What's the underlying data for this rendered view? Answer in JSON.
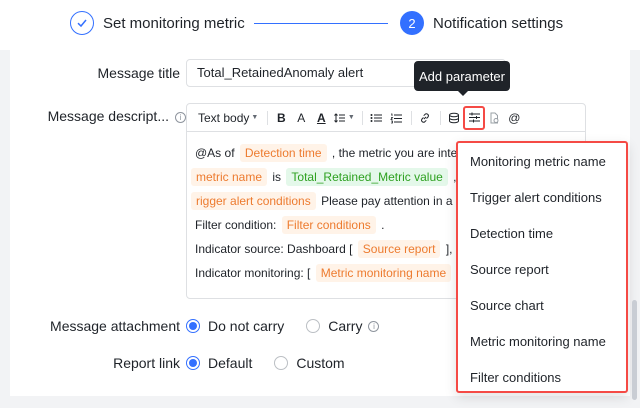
{
  "steps": [
    {
      "number": "",
      "label": "Set monitoring metric",
      "status": "done"
    },
    {
      "number": "2",
      "label": "Notification settings",
      "status": "active"
    }
  ],
  "form": {
    "message_title_label": "Message title",
    "message_title_value": "Total_RetainedAnomaly alert",
    "message_desc_label": "Message descript...",
    "attachment_label": "Message attachment",
    "attachment_options": [
      "Do not carry",
      "Carry"
    ],
    "attachment_selected": "Do not carry",
    "report_link_label": "Report link",
    "report_link_options": [
      "Default",
      "Custom"
    ],
    "report_link_selected": "Default"
  },
  "toolbar": {
    "text_style": "Text body",
    "icons": [
      "caret-down-icon",
      "bold-icon",
      "font-color-icon",
      "text-color-icon",
      "line-height-icon",
      "bullet-list-icon",
      "numbered-list-icon",
      "link-icon",
      "database-icon",
      "add-parameter-icon",
      "attachment-icon",
      "mention-icon"
    ]
  },
  "editor_content": {
    "line1": {
      "t1": "@As of",
      "tag1": "Detection time",
      "t2": ", the metric you are inte"
    },
    "line2": {
      "tag1": "metric name",
      "t1": "is",
      "tag2": "Total_Retained_Metric value",
      "t2": ","
    },
    "line3": {
      "tag1": "rigger alert conditions",
      "t1": "Please pay attention in a"
    },
    "line4": {
      "t1": "Filter condition:",
      "tag1": "Filter conditions",
      "t2": "."
    },
    "line5": {
      "t1": "Indicator source: Dashboard [",
      "tag1": "Source report",
      "t2": "], c"
    },
    "line6": {
      "t1": "Indicator monitoring: [",
      "tag1": "Metric monitoring name"
    }
  },
  "tooltip": {
    "text": "Add parameter"
  },
  "dropdown": {
    "items": [
      "Monitoring metric name",
      "Trigger alert conditions",
      "Detection time",
      "Source report",
      "Source chart",
      "Metric monitoring name",
      "Filter conditions"
    ]
  },
  "colors": {
    "primary": "#3370ff",
    "highlight_border": "#f54a45",
    "tag_orange_text": "#ed7b2f",
    "tag_orange_bg": "#fff3e8",
    "tag_green_text": "#2ea121",
    "tag_green_bg": "#e4f8ea"
  }
}
